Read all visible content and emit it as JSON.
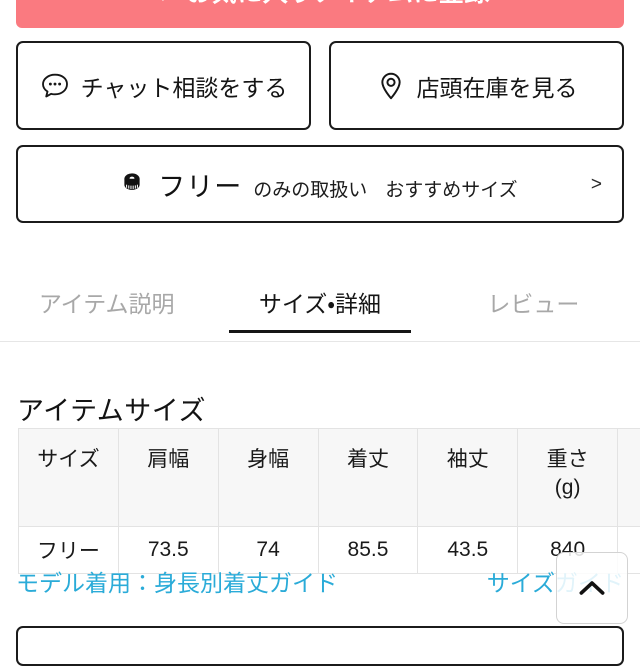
{
  "cta": {
    "label": "お気に入りアイテムに登録",
    "icon": "heart-icon",
    "color": "#fa7a80"
  },
  "action_buttons": [
    {
      "label": "チャット相談をする",
      "icon": "chat-bubble-icon"
    },
    {
      "label": "店頭在庫を見る",
      "icon": "location-pin-icon"
    }
  ],
  "size_bar": {
    "icon": "tape-measure-icon",
    "size": "フリー",
    "note": "のみの取扱い",
    "recommend": "おすすめサイズ",
    "chevron": ">"
  },
  "tabs": [
    {
      "label": "アイテム説明",
      "active": false
    },
    {
      "label": "サイズ・詳細",
      "active": true
    },
    {
      "label": "レビュー",
      "active": false
    }
  ],
  "item_size": {
    "title": "アイテムサイズ",
    "columns": [
      "サイズ",
      "肩幅",
      "身幅",
      "着丈",
      "袖丈",
      "重さ\n(g)",
      ""
    ],
    "rows": [
      [
        "フリー",
        "73.5",
        "74",
        "85.5",
        "43.5",
        "840",
        ""
      ]
    ]
  },
  "guide_links": [
    {
      "label": "モデル着用：身長別着丈ガイド"
    },
    {
      "label": "サイズガイド"
    }
  ],
  "scroll_top": {
    "icon": "chevron-up-icon"
  },
  "colors": {
    "accent_red": "#fa7a80",
    "link_blue": "#2aabd8",
    "text": "#151515",
    "muted_text": "#a8a8a8",
    "table_header_bg": "#f7f7f7",
    "border": "#e3e3e3"
  }
}
